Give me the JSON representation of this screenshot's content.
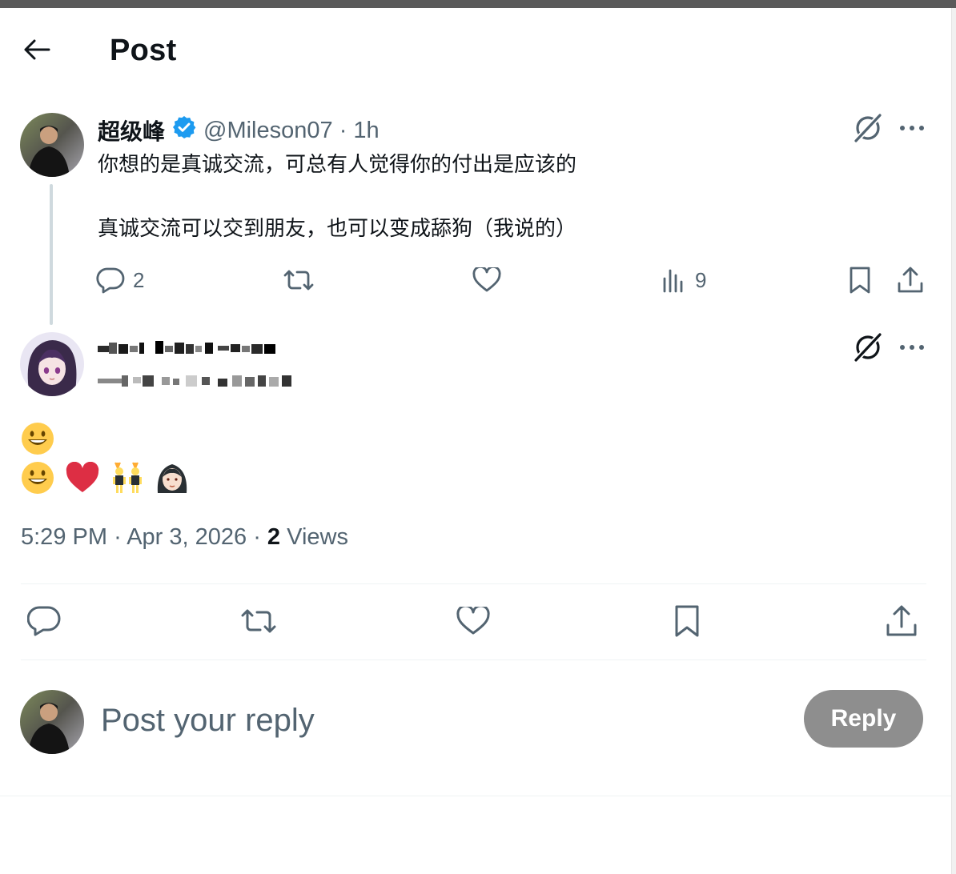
{
  "header": {
    "title": "Post",
    "back_icon": "arrow-left-icon"
  },
  "post": {
    "author_name": "超级峰",
    "verified_icon": "verified-badge-icon",
    "handle_time": "@Mileson07 · 1h",
    "text_line_1": "你想的是真诚交流，可总有人觉得你的付出是应该的",
    "text_line_2": "真诚交流可以交到朋友，也可以变成舔狗（我说的）",
    "actions": {
      "reply_count": "2",
      "views_count": "9"
    }
  },
  "reply": {
    "emoji_line_1": [
      "grinning-face"
    ],
    "emoji_line_2": [
      "grinning-face",
      "red-heart",
      "men-with-bunny-ears",
      "woman-light-skin"
    ],
    "time": "5:29 PM",
    "date": "Apr 3, 2026",
    "views_count": "2",
    "views_label": "Views"
  },
  "composer": {
    "placeholder": "Post your reply",
    "reply_button": "Reply"
  },
  "colors": {
    "text": "#0f1419",
    "secondary": "#536471",
    "verified_blue": "#1d9bf0",
    "divider": "#eff3f4",
    "disabled_button": "#8e8e8e"
  }
}
